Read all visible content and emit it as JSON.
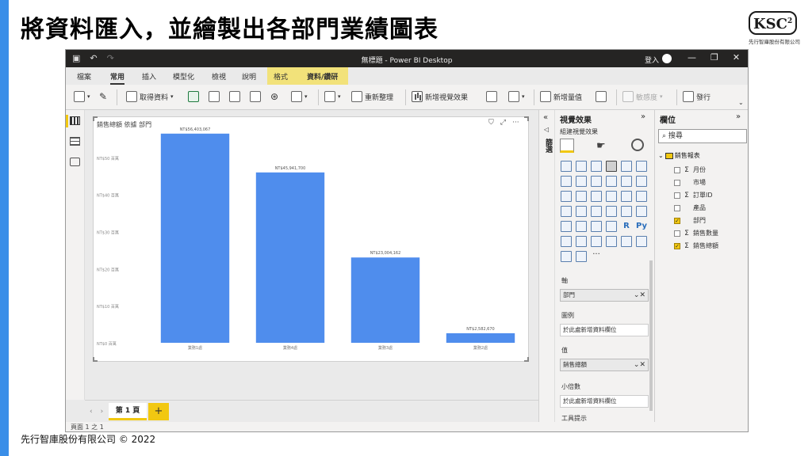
{
  "slide": {
    "title": "將資料匯入，並繪製出各部門業績圖表",
    "logo_mark": "KSC",
    "logo_sup": "2",
    "logo_sub": "先行智庫股份有限公司",
    "footer": "先行智庫股份有限公司 © 2022"
  },
  "window": {
    "title": "無標題 - Power BI Desktop",
    "login": "登入",
    "controls": [
      "—",
      "❐",
      "✕"
    ]
  },
  "menu": {
    "items": [
      "檔案",
      "常用",
      "插入",
      "模型化",
      "檢視",
      "說明",
      "格式",
      "資料/鑽研"
    ],
    "active": "常用"
  },
  "ribbon": {
    "get_data": "取得資料",
    "refresh": "重新整理",
    "new_visual": "新增視覺效果",
    "new_measure": "新增量值",
    "sensitivity": "敏感度",
    "publish": "發行"
  },
  "visual": {
    "title": "銷售總額 依據 部門",
    "icons": [
      "filter-icon",
      "focus-icon",
      "more-icon"
    ]
  },
  "chart_data": {
    "type": "bar",
    "title": "銷售總額 依據 部門",
    "categories": [
      "業務1處",
      "業務4處",
      "業務3處",
      "業務2處"
    ],
    "values": [
      56403067,
      45941700,
      23004162,
      2582670
    ],
    "data_labels": [
      "NT$56,403,067",
      "NT$45,941,700",
      "NT$23,004,162",
      "NT$2,582,670"
    ],
    "ytick_labels": [
      "NT$0 百萬",
      "NT$10 百萬",
      "NT$20 百萬",
      "NT$30 百萬",
      "NT$40 百萬",
      "NT$50 百萬"
    ],
    "yticks": [
      0,
      10000000,
      20000000,
      30000000,
      40000000,
      50000000
    ],
    "ylim": [
      0,
      57000000
    ],
    "color": "#4f8ded",
    "grid": false,
    "legend": "none"
  },
  "pages": {
    "nav_prev": "‹",
    "nav_next": "›",
    "tab": "第 1 頁",
    "add": "+"
  },
  "status": "頁面 1 之 1",
  "filters_pane": {
    "label": "篩選"
  },
  "viz_pane": {
    "title": "視覺效果",
    "subtitle": "組建視覺效果",
    "r_label": "R",
    "py_label": "Py",
    "more": "···",
    "axis_label": "軸",
    "axis_field": "部門",
    "legend_label": "圖例",
    "legend_placeholder": "於此處新增資料欄位",
    "values_label": "值",
    "values_field": "銷售總額",
    "small_multiples_label": "小倍數",
    "small_multiples_placeholder": "於此處新增資料欄位",
    "tooltips_label": "工具提示"
  },
  "fields_pane": {
    "title": "欄位",
    "search_placeholder": "搜尋",
    "table_name": "銷售報表",
    "fields": [
      {
        "name": "月份",
        "sigma": true,
        "checked": false
      },
      {
        "name": "市場",
        "sigma": false,
        "checked": false
      },
      {
        "name": "訂單ID",
        "sigma": true,
        "checked": false
      },
      {
        "name": "產品",
        "sigma": false,
        "checked": false
      },
      {
        "name": "部門",
        "sigma": false,
        "checked": true
      },
      {
        "name": "銷售數量",
        "sigma": true,
        "checked": false
      },
      {
        "name": "銷售總額",
        "sigma": true,
        "checked": true
      }
    ]
  }
}
